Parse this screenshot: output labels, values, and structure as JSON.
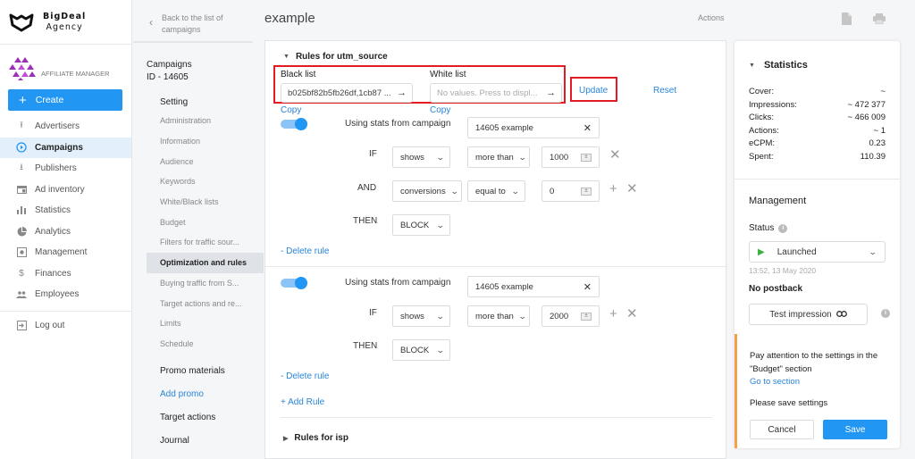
{
  "brand": {
    "name_line1": "BigDeal",
    "name_line2": "Agency"
  },
  "role": {
    "label": "AFFILIATE MANAGER"
  },
  "sidebar": {
    "create_label": "Create",
    "items": [
      {
        "label": "Advertisers",
        "icon": "upload-icon"
      },
      {
        "label": "Campaigns",
        "icon": "play-circle-icon",
        "active": true
      },
      {
        "label": "Publishers",
        "icon": "download-icon"
      },
      {
        "label": "Ad inventory",
        "icon": "inventory-icon"
      },
      {
        "label": "Statistics",
        "icon": "bar-chart-icon"
      },
      {
        "label": "Analytics",
        "icon": "pie-chart-icon"
      },
      {
        "label": "Management",
        "icon": "settings-box-icon"
      },
      {
        "label": "Finances",
        "icon": "dollar-icon"
      },
      {
        "label": "Employees",
        "icon": "people-icon"
      }
    ],
    "logout_label": "Log out"
  },
  "subnav": {
    "back_label": "Back to the list of campaigns",
    "campaign_title": "Campaigns",
    "campaign_id": "ID - 14605",
    "setting_header": "Setting",
    "setting_items": [
      "Administration",
      "Information",
      "Audience",
      "Keywords",
      "White/Black lists",
      "Budget",
      "Filters for traffic sour...",
      "Optimization and rules",
      "Buying traffic from S...",
      "Target actions and re...",
      "Limits",
      "Schedule"
    ],
    "active_item": "Optimization and rules",
    "promo_header": "Promo materials",
    "add_promo": "Add promo",
    "target_actions": "Target actions",
    "journal": "Journal"
  },
  "header": {
    "title": "example",
    "actions_label": "Actions"
  },
  "rules": {
    "section_title": "Rules for utm_source",
    "black_list_label": "Black list",
    "black_list_value": "b025bf82b5fb26df,1cb87 ...",
    "white_list_label": "White list",
    "white_list_placeholder": "No values. Press to displ...",
    "update_label": "Update",
    "reset_label": "Reset",
    "copy_label": "Copy",
    "using_stats_label": "Using stats from campaign",
    "if_label": "IF",
    "and_label": "AND",
    "then_label": "THEN",
    "delete_rule_label": "- Delete rule",
    "add_rule_label": "+ Add Rule",
    "rule1": {
      "enabled": true,
      "campaign": "14605 example",
      "cond1": {
        "metric": "shows",
        "operator": "more than",
        "value": "1000"
      },
      "cond2": {
        "metric": "conversions",
        "operator": "equal to",
        "value": "0"
      },
      "action": "BLOCK"
    },
    "rule2": {
      "enabled": true,
      "campaign": "14605 example",
      "cond1": {
        "metric": "shows",
        "operator": "more than",
        "value": "2000"
      },
      "action": "BLOCK"
    },
    "isp_section_title": "Rules for isp"
  },
  "statistics": {
    "title": "Statistics",
    "rows": [
      {
        "label": "Cover:",
        "value": "~"
      },
      {
        "label": "Impressions:",
        "value": "~ 472 377"
      },
      {
        "label": "Clicks:",
        "value": "~ 466 009"
      },
      {
        "label": "Actions:",
        "value": "~ 1"
      },
      {
        "label": "eCPM:",
        "value": "0.23"
      },
      {
        "label": "Spent:",
        "value": "110.39"
      }
    ]
  },
  "management": {
    "title": "Management",
    "status_label": "Status",
    "status_value": "Launched",
    "status_timestamp": "13:52, 13 May 2020",
    "postback": "No postback",
    "test_impression_label": "Test impression",
    "warning_text": "Pay attention to the settings in the \"Budget\" section",
    "go_to_section": "Go to section",
    "save_notice": "Please save settings",
    "cancel_label": "Cancel",
    "save_label": "Save"
  },
  "colors": {
    "accent": "#2196f3",
    "link": "#2a85d8",
    "highlight": "#e31c24",
    "warning": "#f5a04a",
    "status_ok": "#3cb043"
  }
}
